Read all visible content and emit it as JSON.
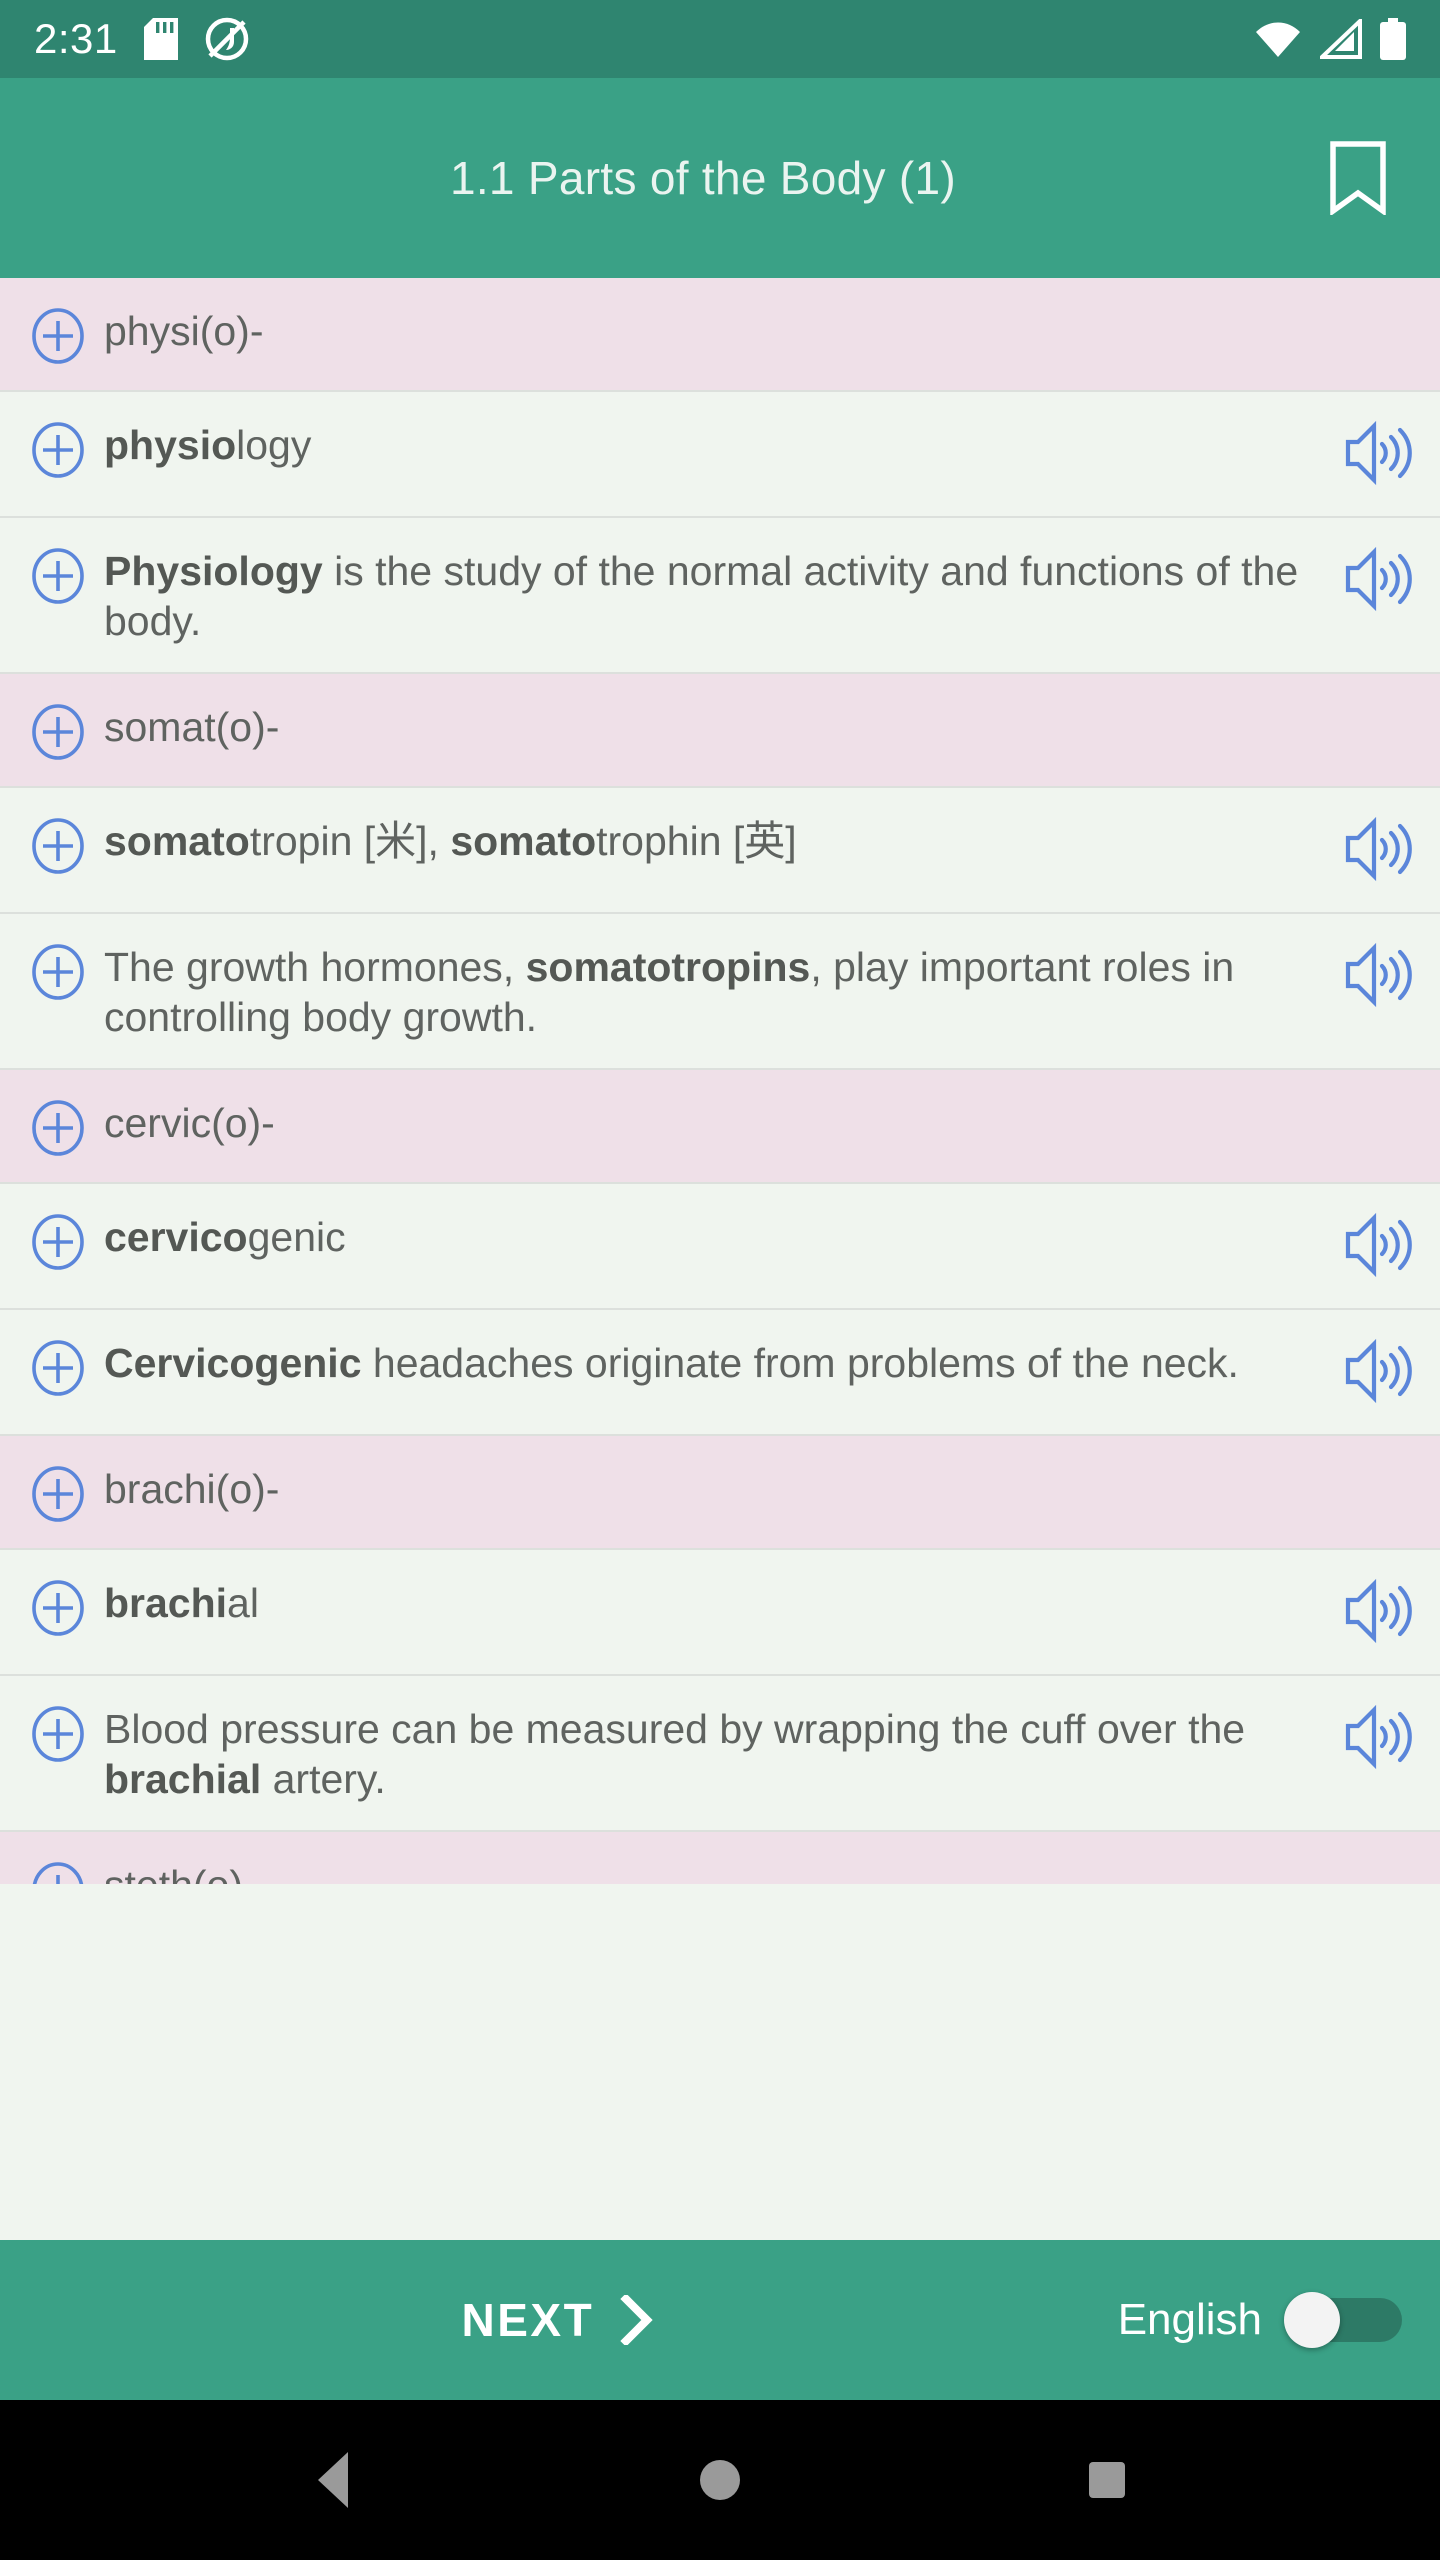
{
  "status_bar": {
    "clock": "2:31",
    "icons": [
      "sd-card-icon",
      "do-not-disturb-icon",
      "wifi-icon",
      "cellular-signal-icon",
      "battery-icon"
    ],
    "background_color": "#2F8570"
  },
  "app_bar": {
    "title": "1.1 Parts of the Body (1)",
    "bookmark_icon": "bookmark-icon",
    "background_color": "#3AA186",
    "title_color": "#EAF4F0"
  },
  "colors": {
    "root_row": "#EFE0E8",
    "entry_row": "#F0F5EF",
    "divider": "#DCE0DC",
    "text": "#5F6360",
    "icon_blue": "#5B86DA",
    "accent_green": "#3AA186",
    "nav_bar": "#000000"
  },
  "list": {
    "expand_icon": "plus-circle-icon",
    "speaker_icon": "speaker-volume-icon",
    "rows": [
      {
        "type": "root",
        "text": "physi(o)-",
        "bold_prefix": "",
        "audio": false
      },
      {
        "type": "entry",
        "text": "physiology",
        "bold_prefix": "physio",
        "audio": true
      },
      {
        "type": "entry",
        "text": "Physiology is the study of the normal activity and functions of the body.",
        "bold_prefix": "Physiology",
        "audio": true
      },
      {
        "type": "root",
        "text": "somat(o)-",
        "bold_prefix": "",
        "audio": false
      },
      {
        "type": "entry",
        "text": "somatotropin [米], somatotrophin [英]",
        "bold_prefix": "",
        "audio": true,
        "segments": [
          {
            "t": "somato",
            "b": true
          },
          {
            "t": "tropin [米], ",
            "b": false
          },
          {
            "t": "somato",
            "b": true
          },
          {
            "t": "trophin [英]",
            "b": false
          }
        ]
      },
      {
        "type": "entry",
        "text": "The growth hormones, somatotropins, play important roles in controlling body growth.",
        "audio": true,
        "segments": [
          {
            "t": "The growth hormones, ",
            "b": false
          },
          {
            "t": "somatotropins",
            "b": true
          },
          {
            "t": ", play important roles in controlling body growth.",
            "b": false
          }
        ]
      },
      {
        "type": "root",
        "text": "cervic(o)-",
        "bold_prefix": "",
        "audio": false
      },
      {
        "type": "entry",
        "text": "cervicogenic",
        "bold_prefix": "cervico",
        "audio": true
      },
      {
        "type": "entry",
        "text": "Cervicogenic headaches originate from problems of the neck.",
        "bold_prefix": "Cervicogenic",
        "audio": true
      },
      {
        "type": "root",
        "text": "brachi(o)-",
        "bold_prefix": "",
        "audio": false
      },
      {
        "type": "entry",
        "text": "brachial",
        "bold_prefix": "brachi",
        "audio": true
      },
      {
        "type": "entry",
        "text": "Blood pressure can be measured by wrapping the cuff over the brachial artery.",
        "audio": true,
        "segments": [
          {
            "t": "Blood pressure can be measured by wrapping the cuff over the ",
            "b": false
          },
          {
            "t": "brachial",
            "b": true
          },
          {
            "t": " artery.",
            "b": false
          }
        ]
      },
      {
        "type": "root",
        "text": "steth(o)-",
        "bold_prefix": "",
        "audio": false,
        "clipped": true
      }
    ]
  },
  "bottom_bar": {
    "next_label": "NEXT",
    "next_icon": "chevron-right-icon",
    "language_label": "English",
    "language_toggle_state": "off"
  },
  "nav_bar": {
    "back_label": "back-icon",
    "home_label": "home-icon",
    "recents_label": "recents-icon"
  }
}
